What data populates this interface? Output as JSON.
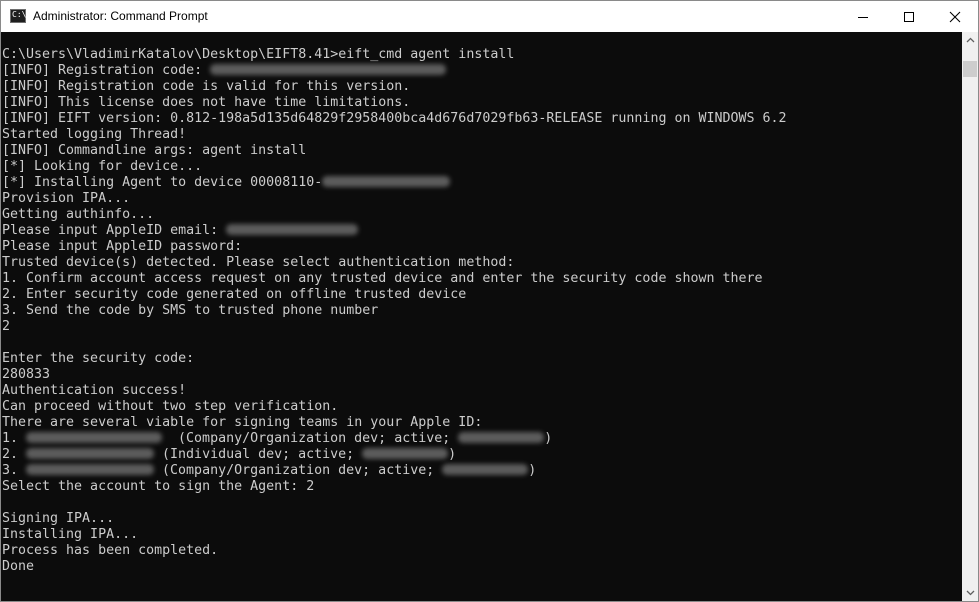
{
  "window": {
    "title": "Administrator: Command Prompt",
    "icon": "command-prompt-icon",
    "controls": [
      "minimize-icon",
      "maximize-icon",
      "close-icon"
    ]
  },
  "terminal": {
    "lines": [
      [
        {
          "t": "C:\\Users\\VladimirKatalov\\Desktop\\EIFT8.41>eift_cmd agent install"
        }
      ],
      [
        {
          "t": "[INFO] Registration code: "
        },
        {
          "redacted": "1",
          "w": 236
        }
      ],
      [
        {
          "t": "[INFO] Registration code is valid for this version."
        }
      ],
      [
        {
          "t": "[INFO] This license does not have time limitations."
        }
      ],
      [
        {
          "t": "[INFO] EIFT version: 0.812-198a5d135d64829f2958400bca4d676d7029fb63-RELEASE running on WINDOWS 6.2"
        }
      ],
      [
        {
          "t": "Started logging Thread!"
        }
      ],
      [
        {
          "t": "[INFO] Commandline args: agent install"
        }
      ],
      [
        {
          "t": "[*] Looking for device..."
        }
      ],
      [
        {
          "t": "[*] Installing Agent to device 00008110-"
        },
        {
          "redacted": "1",
          "w": 128
        }
      ],
      [
        {
          "t": "Provision IPA..."
        }
      ],
      [
        {
          "t": "Getting authinfo..."
        }
      ],
      [
        {
          "t": "Please input AppleID email: "
        },
        {
          "redacted": "1",
          "w": 132
        }
      ],
      [
        {
          "t": "Please input AppleID password:"
        }
      ],
      [
        {
          "t": "Trusted device(s) detected. Please select authentication method:"
        }
      ],
      [
        {
          "t": "1. Confirm account access request on any trusted device and enter the security code shown there"
        }
      ],
      [
        {
          "t": "2. Enter security code generated on offline trusted device"
        }
      ],
      [
        {
          "t": "3. Send the code by SMS to trusted phone number"
        }
      ],
      [
        {
          "t": "2"
        }
      ],
      [
        {
          "t": ""
        }
      ],
      [
        {
          "t": "Enter the security code:"
        }
      ],
      [
        {
          "t": "280833"
        }
      ],
      [
        {
          "t": "Authentication success!"
        }
      ],
      [
        {
          "t": "Can proceed without two step verification."
        }
      ],
      [
        {
          "t": "There are several viable for signing teams in your Apple ID:"
        }
      ],
      [
        {
          "t": "1. "
        },
        {
          "redacted": "1",
          "w": 136
        },
        {
          "t": "  (Company/Organization dev; active; "
        },
        {
          "redacted": "1",
          "w": 86
        },
        {
          "t": ")"
        }
      ],
      [
        {
          "t": "2. "
        },
        {
          "redacted": "1",
          "w": 128
        },
        {
          "t": " (Individual dev; active; "
        },
        {
          "redacted": "1",
          "w": 86
        },
        {
          "t": ")"
        }
      ],
      [
        {
          "t": "3. "
        },
        {
          "redacted": "1",
          "w": 128
        },
        {
          "t": " (Company/Organization dev; active; "
        },
        {
          "redacted": "1",
          "w": 86
        },
        {
          "t": ")"
        }
      ],
      [
        {
          "t": "Select the account to sign the Agent: 2"
        }
      ],
      [
        {
          "t": ""
        }
      ],
      [
        {
          "t": "Signing IPA..."
        }
      ],
      [
        {
          "t": "Installing IPA..."
        }
      ],
      [
        {
          "t": "Process has been completed."
        }
      ],
      [
        {
          "t": "Done"
        }
      ]
    ]
  },
  "scrollbar": {
    "up_icon": "chevron-up-icon",
    "down_icon": "chevron-down-icon"
  },
  "colors": {
    "terminal_background": "#0c0c0c",
    "terminal_text": "#cccccc",
    "titlebar": "#ffffff",
    "scrollbar_track": "#f0f0f0",
    "scrollbar_thumb": "#cdcdcd"
  }
}
